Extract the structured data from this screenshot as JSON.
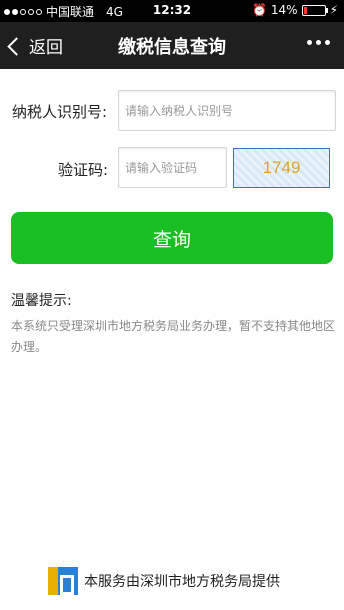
{
  "status_bar": {
    "carrier": "中国联通",
    "network": "4G",
    "time": "12:32",
    "battery": "14%",
    "battery_level": 0.14
  },
  "nav": {
    "back_label": "返回",
    "title": "缴税信息查询"
  },
  "form": {
    "taxpayer_label": "纳税人识别号:",
    "taxpayer_placeholder": "请输入纳税人识别号",
    "captcha_label": "验证码:",
    "captcha_placeholder": "请输入验证码",
    "captcha_code": "1749"
  },
  "query_button": "查询",
  "tips": {
    "title": "温馨提示:",
    "body": "本系统只受理深圳市地方税务局业务办理，暂不支持其他地区办理。"
  },
  "footer": {
    "text": "本服务由深圳市地方税务局提供"
  },
  "colors": {
    "accent": "#19be23",
    "nav_bg": "#1f1f1f",
    "captcha_text": "#e0a12a"
  }
}
